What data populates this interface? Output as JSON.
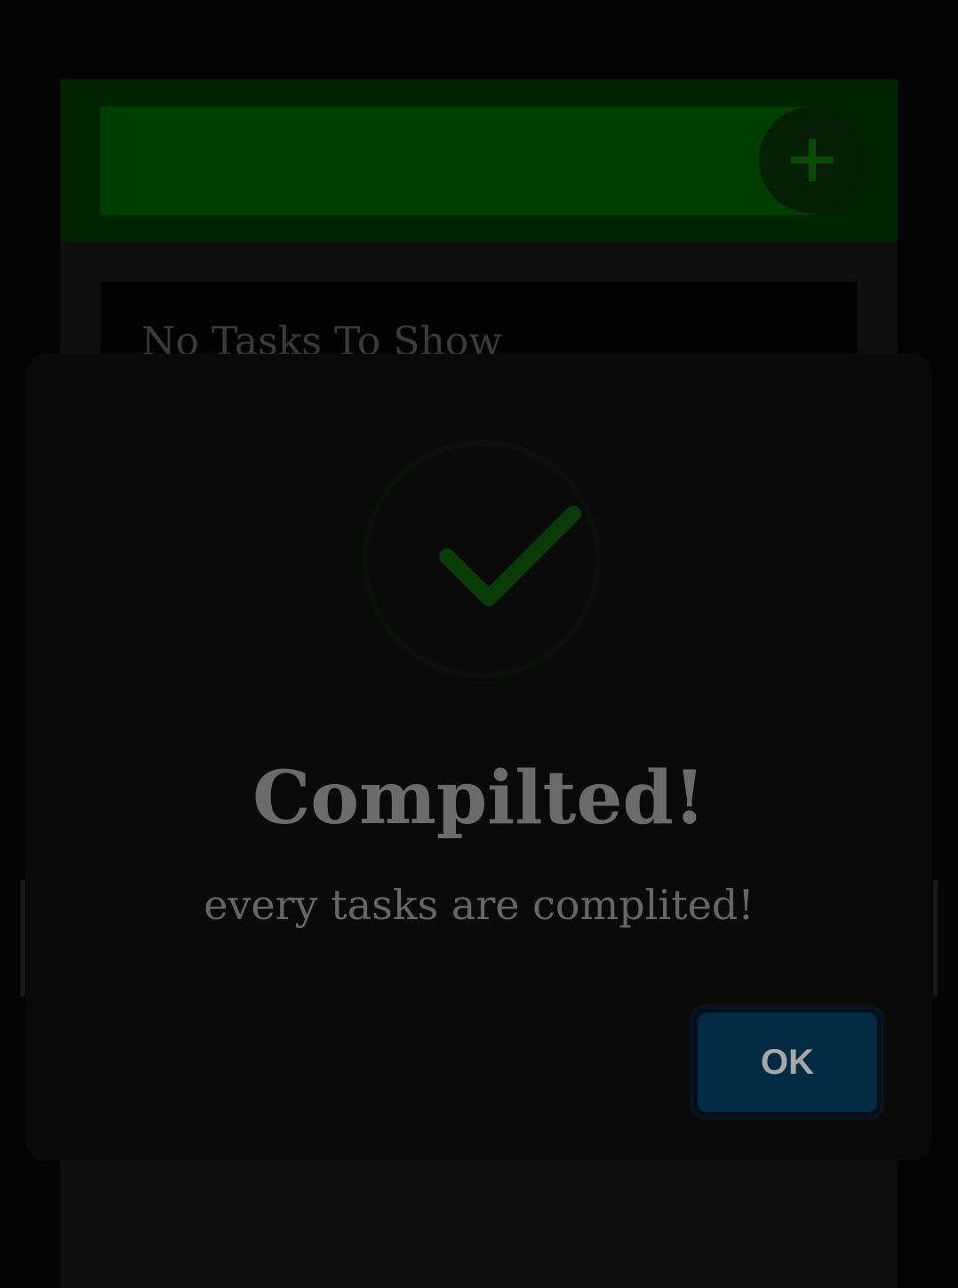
{
  "app": {
    "task_input": {
      "value": "",
      "placeholder": ""
    },
    "add_button": {
      "icon": "plus-icon"
    },
    "task_list": {
      "empty_message": "No Tasks To Show"
    }
  },
  "dialog": {
    "icon": "checkmark-icon",
    "title": "Compilted!",
    "message": "every tasks are complited!",
    "ok_label": "OK"
  },
  "colors": {
    "header": "#012401",
    "input": "#003e00",
    "accent_green": "#0a4a06",
    "ok_button": "#022a42",
    "dialog_bg": "#0a0a0a"
  }
}
